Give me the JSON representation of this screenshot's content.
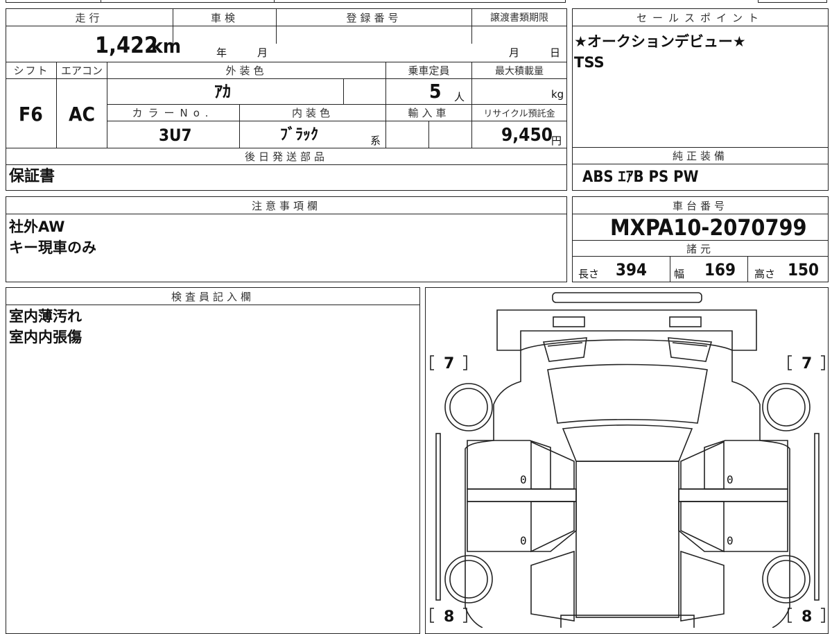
{
  "top": {
    "mileage_label": "走行",
    "mileage_value": "1,422",
    "mileage_unit": "km",
    "shaken_label": "車検",
    "shaken_year": "年",
    "shaken_month": "月",
    "registration_label": "登録番号",
    "deadline_label": "譲渡書類期限",
    "deadline_month": "月",
    "deadline_day": "日"
  },
  "specs": {
    "shift_label": "シフト",
    "shift_value": "F6",
    "aircon_label": "エアコン",
    "aircon_value": "AC",
    "exterior_label": "外装色",
    "exterior_value": "ｱｶ",
    "capacity_label": "乗車定員",
    "capacity_value": "5",
    "capacity_unit": "人",
    "maxload_label": "最大積載量",
    "maxload_unit": "kg",
    "colorno_label": "カラーNo.",
    "colorno_value": "3U7",
    "interior_label": "内装色",
    "interior_value": "ﾌﾞﾗｯｸ",
    "interior_suffix": "系",
    "import_label": "輸入車",
    "recycle_label": "リサイクル預託金",
    "recycle_value": "9,450",
    "recycle_unit": "円"
  },
  "sales": {
    "label": "セールスポイント",
    "lines": [
      "★オークションデビュー★",
      "TSS"
    ]
  },
  "later": {
    "label": "後日発送部品",
    "value": "保証書"
  },
  "equipment": {
    "label": "純正装備",
    "value": "ABS ｴｱB PS PW"
  },
  "notes": {
    "label": "注意事項欄",
    "lines": [
      "社外AW",
      "キー現車のみ"
    ]
  },
  "chassis": {
    "label": "車台番号",
    "value": "MXPA10-2070799"
  },
  "dims": {
    "label": "諸元",
    "length_label": "長さ",
    "length_value": "394",
    "width_label": "幅",
    "width_value": "169",
    "height_label": "高さ",
    "height_value": "150"
  },
  "inspector": {
    "label": "検査員記入欄",
    "lines": [
      "室内薄汚れ",
      "室内内張傷"
    ]
  },
  "diagram": {
    "tire_front_left": "7",
    "tire_front_right": "7",
    "tire_rear_left": "8",
    "tire_rear_right": "8",
    "door_front_left": "0",
    "door_front_right": "0",
    "door_rear_left": "0",
    "door_rear_right": "0"
  },
  "colors": {
    "line": "#222222",
    "header_text": "#333333",
    "value_text": "#111111"
  }
}
